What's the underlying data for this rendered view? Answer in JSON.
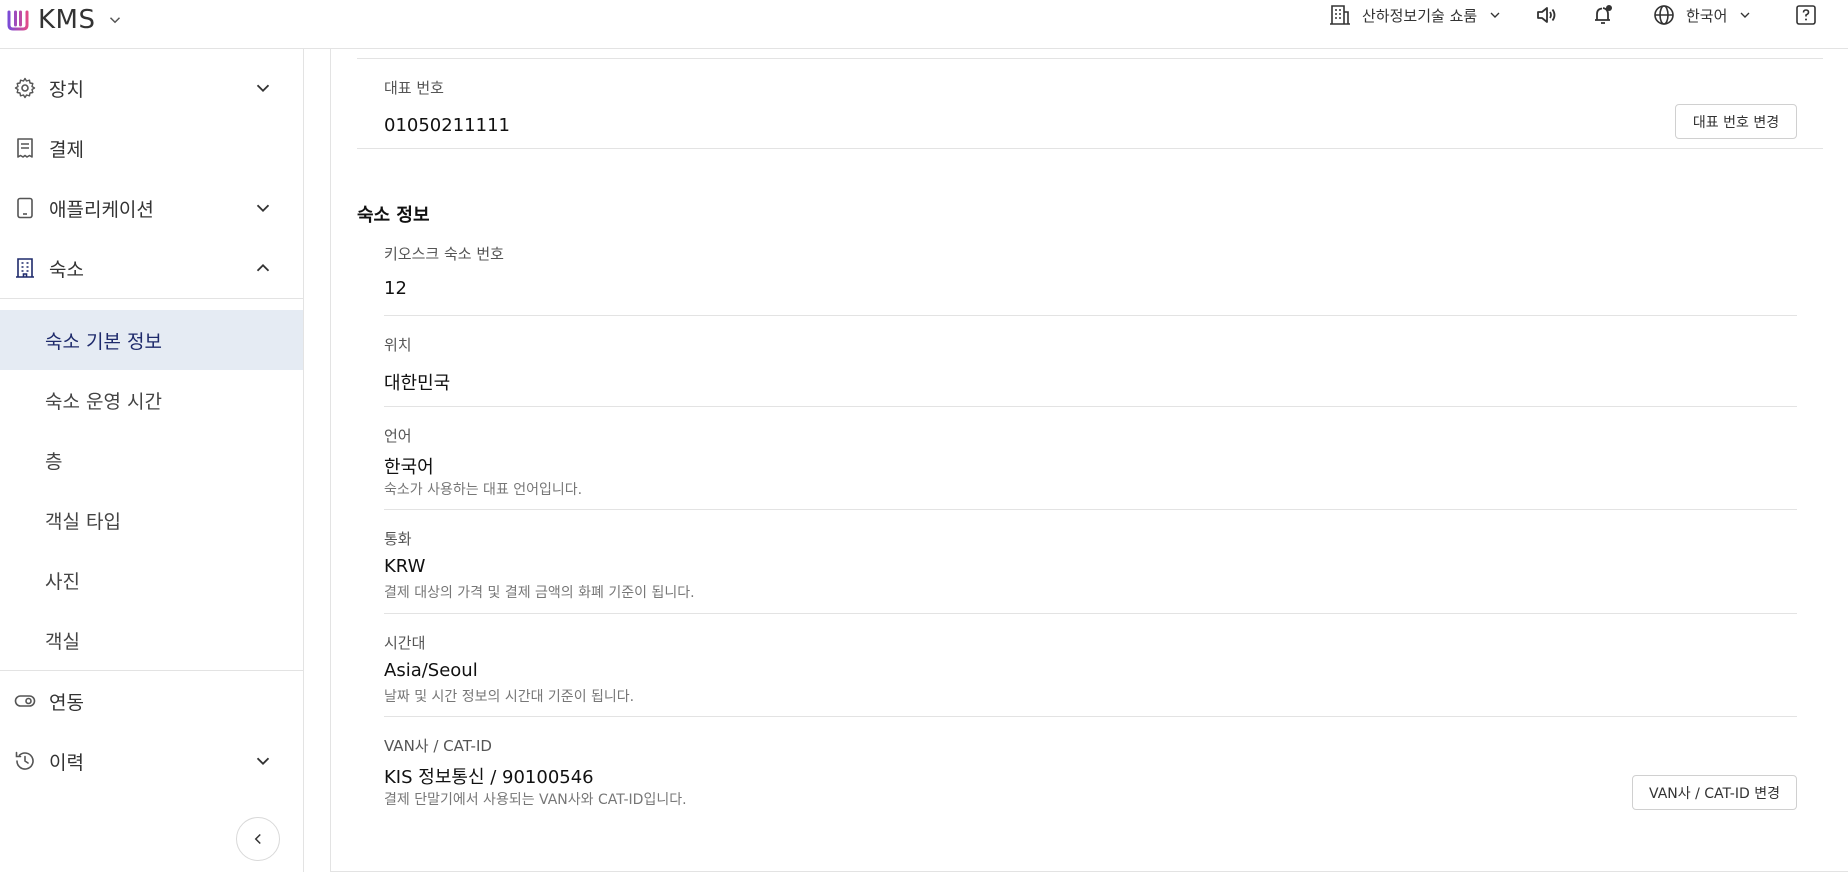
{
  "app": {
    "title": "KMS"
  },
  "header": {
    "shop_name": "산하정보기술 쇼룸",
    "language": "한국어",
    "icons": [
      "building-icon",
      "speaker-icon",
      "bell-icon",
      "globe-icon",
      "help-icon"
    ]
  },
  "sidebar": {
    "items": [
      {
        "label": "장치",
        "icon": "gear-icon",
        "expanded": false
      },
      {
        "label": "결제",
        "icon": "receipt-icon"
      },
      {
        "label": "애플리케이션",
        "icon": "tablet-icon",
        "expanded": false
      },
      {
        "label": "숙소",
        "icon": "building-icon",
        "expanded": true
      },
      {
        "label": "연동",
        "icon": "toggle-icon"
      },
      {
        "label": "이력",
        "icon": "history-icon",
        "expanded": false
      }
    ],
    "subitems": [
      {
        "label": "숙소 기본 정보",
        "active": true
      },
      {
        "label": "숙소 운영 시간"
      },
      {
        "label": "층"
      },
      {
        "label": "객실 타입"
      },
      {
        "label": "사진"
      },
      {
        "label": "객실"
      }
    ]
  },
  "main": {
    "phone": {
      "label": "대표 번호",
      "value": "01050211111",
      "button": "대표 번호 변경"
    },
    "section_title": "숙소 정보",
    "fields": [
      {
        "label": "키오스크 숙소 번호",
        "value": "12"
      },
      {
        "label": "위치",
        "value": "대한민국"
      },
      {
        "label": "언어",
        "value": "한국어",
        "desc": "숙소가 사용하는 대표 언어입니다."
      },
      {
        "label": "통화",
        "value": "KRW",
        "desc": "결제 대상의 가격 및 결제 금액의 화폐 기준이 됩니다."
      },
      {
        "label": "시간대",
        "value": "Asia/Seoul",
        "desc": "날짜 및 시간 정보의 시간대 기준이 됩니다."
      },
      {
        "label": "VAN사 / CAT-ID",
        "value": "KIS 정보통신 / 90100546",
        "desc": "결제 단말기에서 사용되는 VAN사와 CAT-ID입니다.",
        "button": "VAN사 / CAT-ID 변경"
      }
    ]
  },
  "colors": {
    "accent": "#1e2a6b",
    "active_bg": "#e5ebf3",
    "border": "#e3e3e3"
  }
}
